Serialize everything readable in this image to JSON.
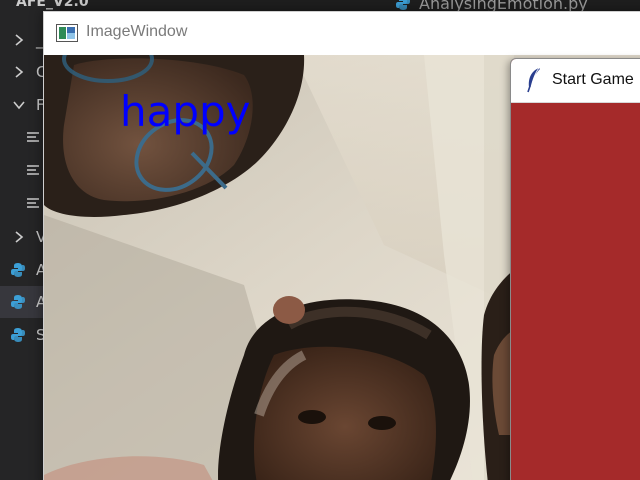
{
  "editor": {
    "explorer_title": "AFE_V2.0",
    "tree": [
      {
        "kind": "folder-collapsed",
        "label": "_"
      },
      {
        "kind": "folder-collapsed",
        "label": "C"
      },
      {
        "kind": "folder-expanded",
        "label": "F"
      },
      {
        "kind": "file",
        "label": ""
      },
      {
        "kind": "file",
        "label": ""
      },
      {
        "kind": "file",
        "label": ""
      },
      {
        "kind": "folder-collapsed",
        "label": "V"
      },
      {
        "kind": "python",
        "label": "A"
      },
      {
        "kind": "python-selected",
        "label": "A"
      },
      {
        "kind": "python",
        "label": "S"
      }
    ],
    "open_tab": "AnalysingEmotion.py"
  },
  "image_window": {
    "title": "ImageWindow",
    "emotion_label": "happy",
    "emotion_color": "#0000ff"
  },
  "game_window": {
    "title": "Start Game",
    "background_color": "#a52a2a"
  },
  "colors": {
    "editor_bg": "#1e1e1e",
    "sidebar_bg": "#252526",
    "python_icon": "#3c9fd6"
  }
}
